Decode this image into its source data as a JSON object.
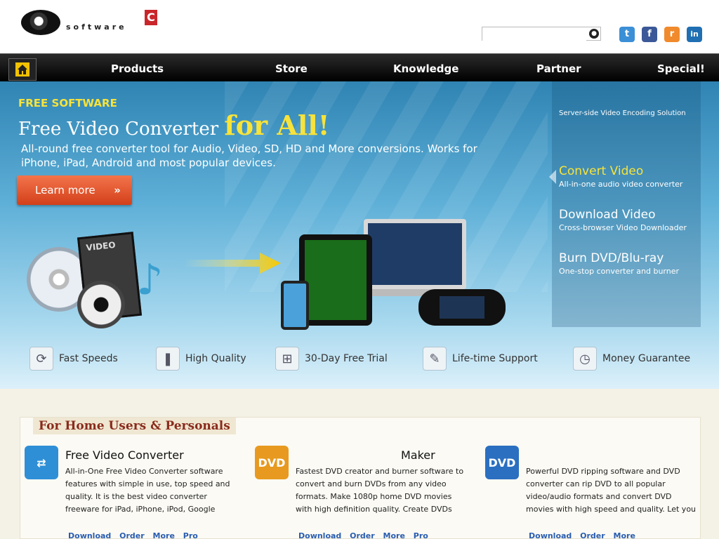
{
  "header": {
    "logo": {
      "wordmark": "software",
      "mark": "C"
    },
    "search": {
      "placeholder": ""
    },
    "social": [
      {
        "name": "twitter",
        "glyph": "t",
        "color": "#3b8fd6"
      },
      {
        "name": "facebook",
        "glyph": "f",
        "color": "#3b5998"
      },
      {
        "name": "rss",
        "glyph": "r",
        "color": "#f08a2c"
      },
      {
        "name": "linkedin",
        "glyph": "in",
        "color": "#1f6fb2"
      }
    ]
  },
  "nav": {
    "items": [
      {
        "label": "Products"
      },
      {
        "label": "Store"
      },
      {
        "label": "Knowledge"
      },
      {
        "label": "Partner"
      },
      {
        "label": "Special!"
      }
    ]
  },
  "hero": {
    "eyebrow": "FREE SOFTWARE",
    "headline_start": "Free Video Converter",
    "headline_end": "for All!",
    "tagline": "All-round free converter tool for Audio, Video, SD, HD and More conversions. Works for iPhone, iPad, Android and most popular devices.",
    "cta": "Learn more",
    "cta_arrows": "»",
    "features": [
      {
        "label": "Fast Speeds",
        "icon": "refresh-icon"
      },
      {
        "label": "High Quality",
        "icon": "bookmark-icon"
      },
      {
        "label": "30-Day Free Trial",
        "icon": "cart-icon"
      },
      {
        "label": "Life-time Support",
        "icon": "wrench-icon"
      },
      {
        "label": "Money Guarantee",
        "icon": "clock-icon"
      }
    ],
    "side": {
      "top_text": "Server-side Video Encoding Solution",
      "items": [
        {
          "title": "Convert Video",
          "sub": "All-in-one audio video converter"
        },
        {
          "title": "Download Video",
          "sub": "Cross-browser Video Downloader"
        },
        {
          "title": "Burn DVD/Blu-ray",
          "sub": "One-stop converter and burner"
        }
      ]
    }
  },
  "products": {
    "heading": "For Home Users & Personals",
    "cards": [
      {
        "title": "Free Video Converter",
        "desc": "All-in-One Free Video Converter software features with simple in use, top speed and quality. It is the best video converter freeware for iPad, iPhone, iPod, Google",
        "icon_color": "#2f8fd6",
        "links": [
          "Download",
          "Order",
          "More",
          "Pro"
        ]
      },
      {
        "title": "Maker",
        "desc": "Fastest DVD creator and burner software to convert and burn DVDs from any video formats. Make 1080p home DVD movies with high definition quality. Create DVDs",
        "icon_color": "#e79a1f",
        "links": [
          "Download",
          "Order",
          "More",
          "Pro"
        ]
      },
      {
        "title": "",
        "desc": "Powerful DVD ripping software and DVD converter can rip DVD to all popular video/audio formats and convert DVD movies with high speed and quality. Let you",
        "icon_color": "#2a6fc0",
        "links": [
          "Download",
          "Order",
          "More"
        ]
      }
    ]
  }
}
